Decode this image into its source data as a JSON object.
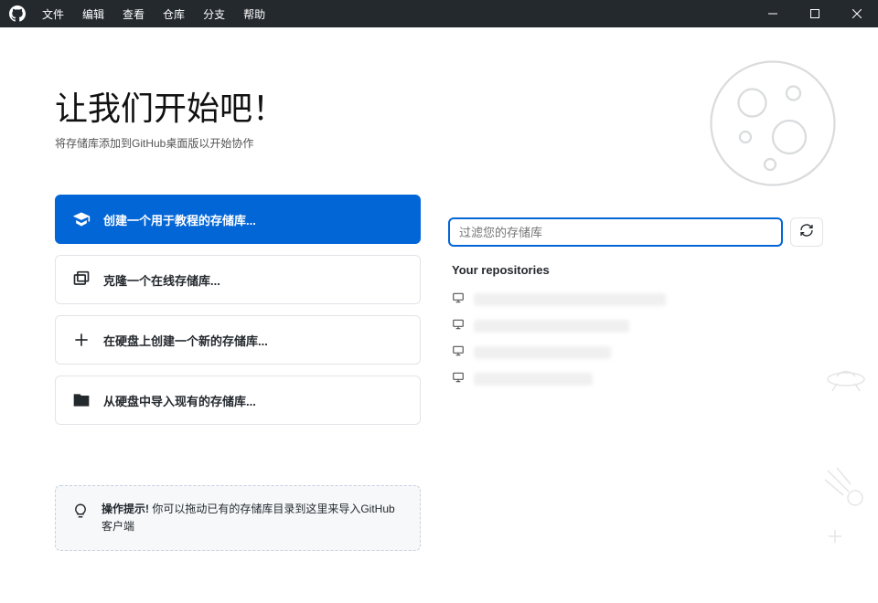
{
  "menu": {
    "file": "文件",
    "edit": "编辑",
    "view": "查看",
    "repo": "仓库",
    "branch": "分支",
    "help": "帮助"
  },
  "welcome": {
    "title": "让我们开始吧！",
    "subtitle": "将存储库添加到GitHub桌面版以开始协作"
  },
  "actions": {
    "tutorial": "创建一个用于教程的存储库...",
    "clone": "克隆一个在线存储库...",
    "create": "在硬盘上创建一个新的存储库...",
    "addLocal": "从硬盘中导入现有的存储库..."
  },
  "tip": {
    "label": "操作提示!",
    "text": " 你可以拖动已有的存储库目录到这里来导入GitHub客户端"
  },
  "filter": {
    "placeholder": "过滤您的存储库"
  },
  "repos": {
    "header": "Your repositories"
  }
}
